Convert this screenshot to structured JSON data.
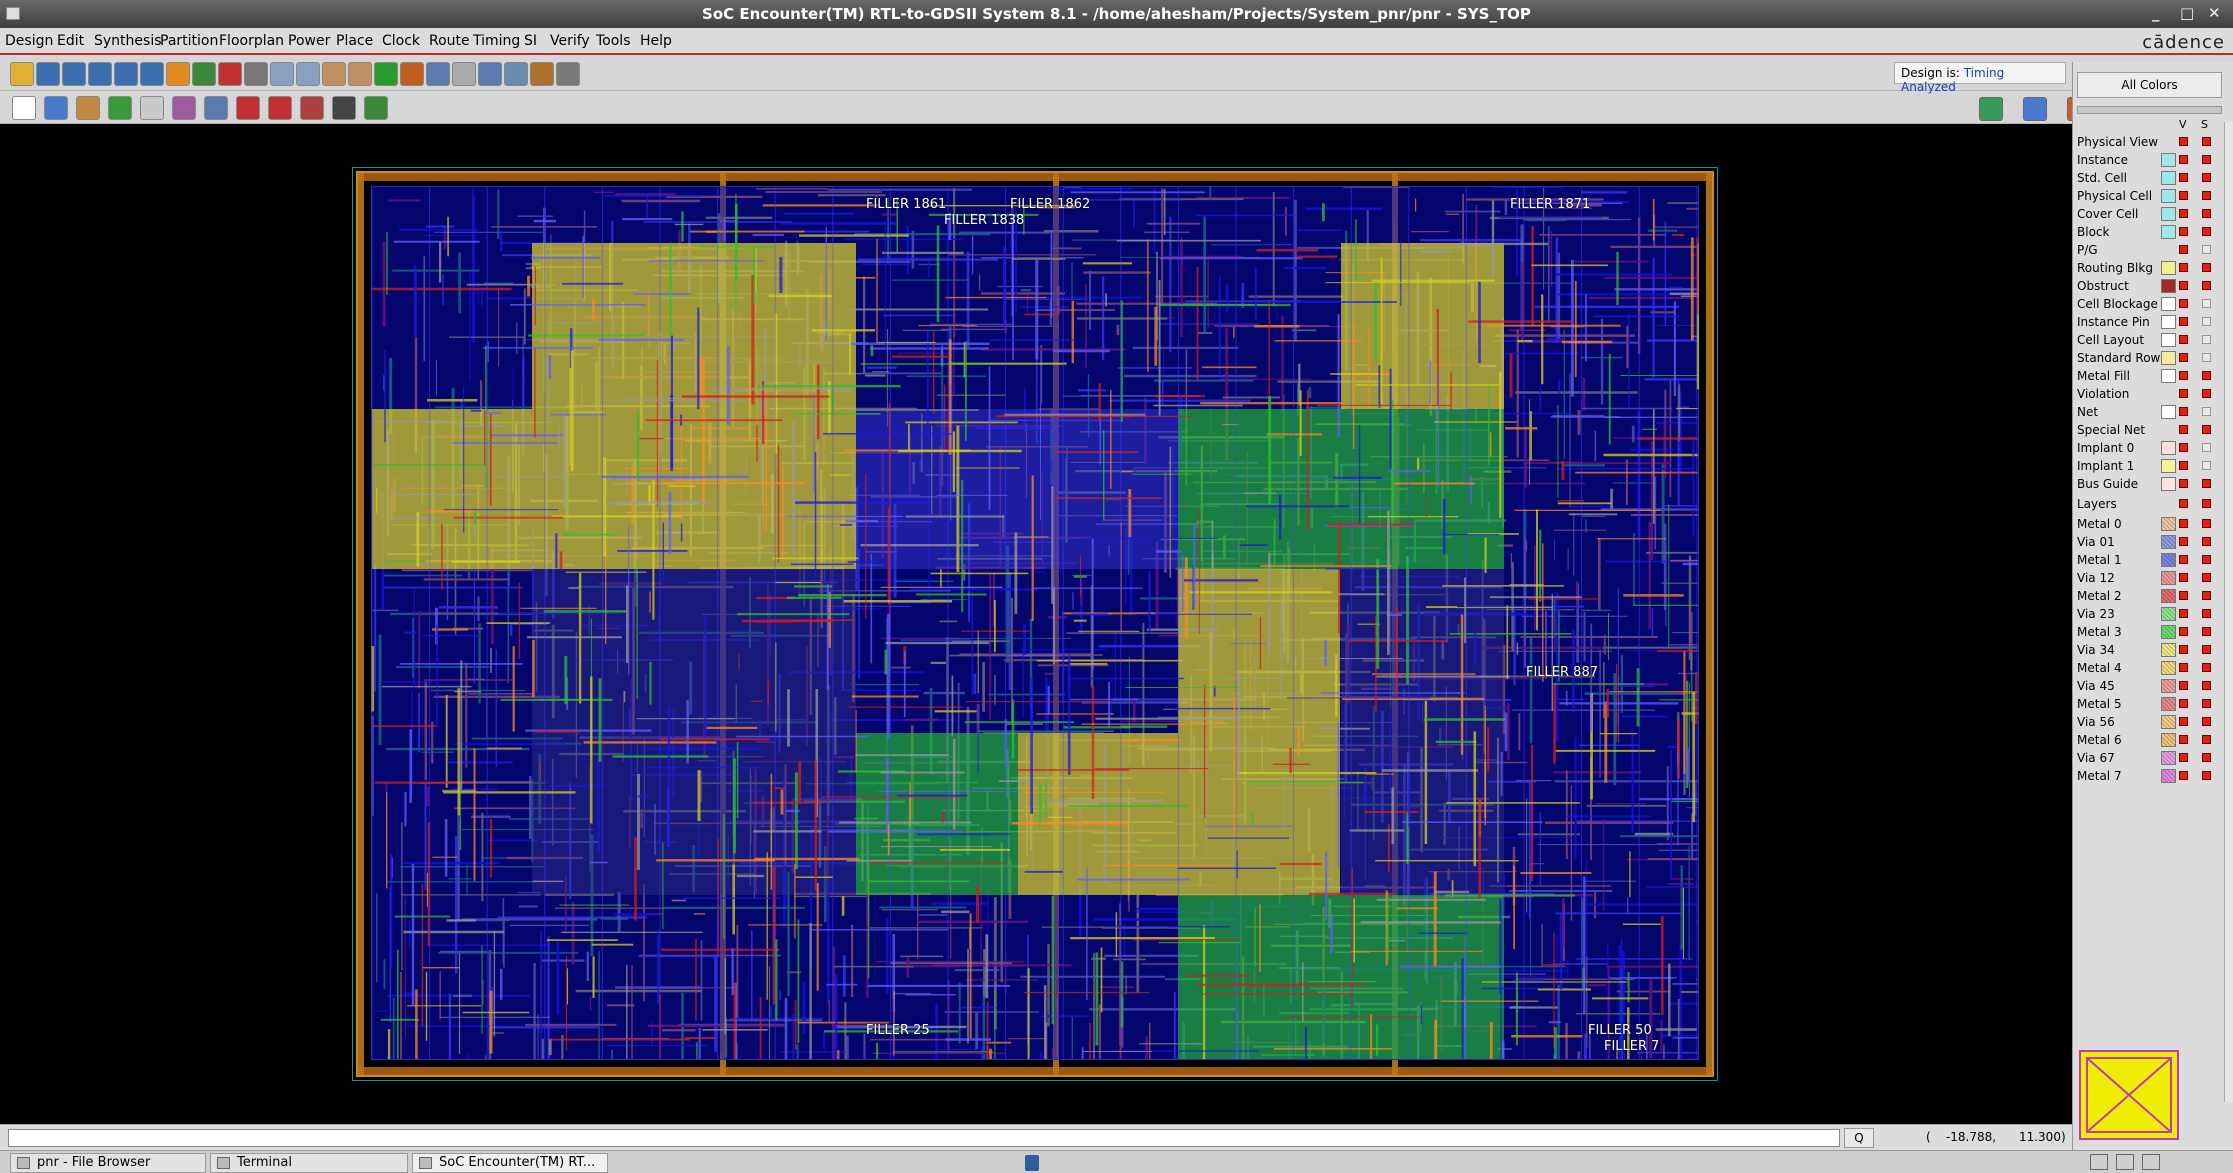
{
  "window": {
    "title": "SoC Encounter(TM) RTL-to-GDSII System 8.1 - /home/ahesham/Projects/System_pnr/pnr - SYS_TOP",
    "buttons": [
      "_",
      "□",
      "✕"
    ]
  },
  "menu": [
    "Design",
    "Edit",
    "Synthesis",
    "Partition",
    "Floorplan",
    "Power",
    "Place",
    "Clock",
    "Route",
    "Timing",
    "SI",
    "Verify",
    "Tools",
    "Help"
  ],
  "brand": "cādence",
  "status": {
    "label": "Design is:",
    "value": "Timing Analyzed"
  },
  "toolbar1": [
    "open-icon",
    "zoom-in-icon",
    "zoom-out-icon",
    "zoom-fit-icon",
    "zoom-area-icon",
    "redraw-icon",
    "refresh-icon",
    "highlight-icon",
    "select-filter-icon",
    "dropdown-icon",
    "move-up-icon",
    "move-down-icon",
    "undo-icon",
    "redo-icon",
    "green-dot-icon",
    "netlist-icon",
    "info-icon",
    "report-icon",
    "browser-icon",
    "layout-icon",
    "wrench-icon",
    "settings-icon"
  ],
  "toolbar2": [
    "pointer-icon",
    "move-icon",
    "ruler-icon",
    "cell-icon",
    "route-icon",
    "edit-wire-icon",
    "split-icon",
    "cut-icon",
    "stretch-icon",
    "add-via-icon",
    "flightline-icon",
    "net-icon"
  ],
  "view_buttons": [
    "floorplan-view-icon",
    "amoeba-view-icon",
    "physical-view-icon"
  ],
  "fillers": [
    "FILLER 1861",
    "FILLER 1862",
    "FILLER 1838",
    "FILLER 1871",
    "FILLER 887",
    "FILLER 25",
    "FILLER 50",
    "FILLER 7"
  ],
  "sidebar": {
    "all_colors": "All Colors",
    "col_v": "V",
    "col_s": "S",
    "items": [
      {
        "label": "Physical View",
        "color": "",
        "v": true,
        "s": true
      },
      {
        "label": "Instance",
        "color": "#9fe8e8",
        "v": true,
        "s": true
      },
      {
        "label": "Std. Cell",
        "color": "#9fe8e8",
        "v": true,
        "s": true
      },
      {
        "label": "Physical Cell",
        "color": "#9fe8e8",
        "v": true,
        "s": true
      },
      {
        "label": "Cover Cell",
        "color": "#9fe8e8",
        "v": true,
        "s": true
      },
      {
        "label": "Block",
        "color": "#9fe8e8",
        "v": true,
        "s": true
      },
      {
        "label": "P/G",
        "color": "",
        "v": true,
        "s": false
      },
      {
        "label": "Routing Blkg",
        "color": "#f2f08a",
        "v": true,
        "s": true
      },
      {
        "label": "Obstruct",
        "color": "#a22a2a",
        "v": true,
        "s": true
      },
      {
        "label": "Cell Blockage",
        "color": "#ffffff",
        "v": true,
        "s": false
      },
      {
        "label": "Instance Pin",
        "color": "#ffffff",
        "v": true,
        "s": false
      },
      {
        "label": "Cell Layout",
        "color": "#ffffff",
        "v": true,
        "s": false
      },
      {
        "label": "Standard Row",
        "color": "#f7e8a0",
        "v": true,
        "s": false
      },
      {
        "label": "Metal Fill",
        "color": "#ffffff",
        "v": true,
        "s": true
      },
      {
        "label": "Violation",
        "color": "",
        "v": true,
        "s": true
      },
      {
        "label": "Net",
        "color": "#ffffff",
        "v": true,
        "s": false
      },
      {
        "label": "Special Net",
        "color": "",
        "v": true,
        "s": true
      },
      {
        "label": "Implant 0",
        "color": "#f9dede",
        "v": true,
        "s": false
      },
      {
        "label": "Implant 1",
        "color": "#f3f29a",
        "v": true,
        "s": false
      },
      {
        "label": "Bus Guide",
        "color": "#fbe4e4",
        "v": true,
        "s": true
      }
    ],
    "layers_label": "Layers",
    "layers": [
      {
        "label": "Metal 0",
        "color": "#f5c9a8"
      },
      {
        "label": "Via 01",
        "color": "#8f9fe8"
      },
      {
        "label": "Metal 1",
        "color": "#7d86e6"
      },
      {
        "label": "Via 12",
        "color": "#f49a9a"
      },
      {
        "label": "Metal 2",
        "color": "#e86a6a"
      },
      {
        "label": "Via 23",
        "color": "#8fe88f"
      },
      {
        "label": "Metal 3",
        "color": "#6fe06f"
      },
      {
        "label": "Via 34",
        "color": "#f2ef8a"
      },
      {
        "label": "Metal 4",
        "color": "#f2e07a"
      },
      {
        "label": "Via 45",
        "color": "#f0a0a0"
      },
      {
        "label": "Metal 5",
        "color": "#e88a8a"
      },
      {
        "label": "Via 56",
        "color": "#f5d08a"
      },
      {
        "label": "Metal 6",
        "color": "#f3c87a"
      },
      {
        "label": "Via 67",
        "color": "#e7a0e7"
      },
      {
        "label": "Metal 7",
        "color": "#e08ae0"
      }
    ]
  },
  "command": {
    "value": "",
    "q_label": "Q",
    "coord": "(    -18.788,      11.300)"
  },
  "taskbar": [
    {
      "label": "pnr - File Browser",
      "active": false
    },
    {
      "label": "Terminal",
      "active": false
    },
    {
      "label": "SoC Encounter(TM) RT...",
      "active": true
    }
  ],
  "colors": {
    "accent": "#c0272d",
    "route_blue": "#1a1ae0",
    "route_yellow": "#d8d020",
    "route_green": "#30c030",
    "route_red": "#d02020"
  }
}
